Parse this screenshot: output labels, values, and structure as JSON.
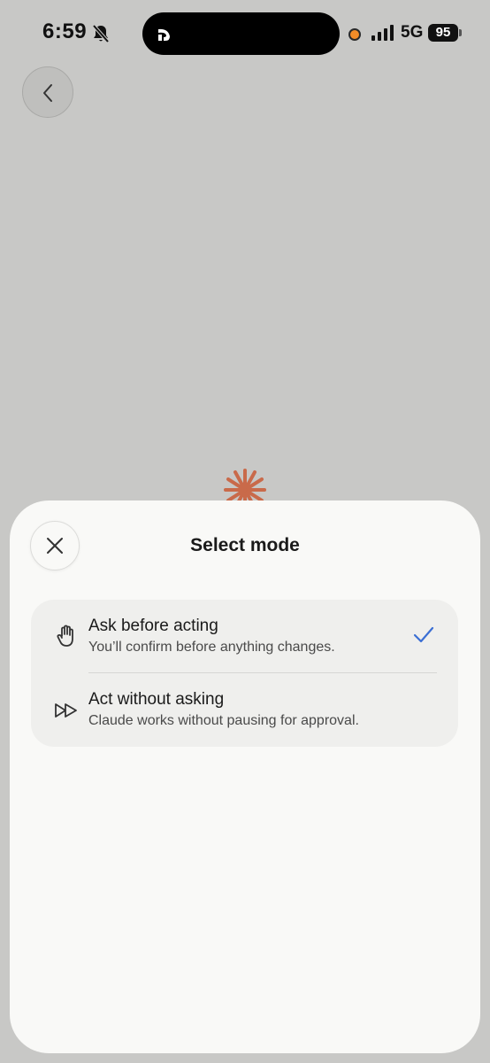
{
  "status_bar": {
    "time": "6:59",
    "network": "5G",
    "battery": "95"
  },
  "sheet": {
    "title": "Select mode",
    "modes": [
      {
        "title": "Ask before acting",
        "description": "You’ll confirm before anything changes.",
        "icon": "hand-icon",
        "selected": true
      },
      {
        "title": "Act without asking",
        "description": "Claude works without pausing for approval.",
        "icon": "fast-forward-icon",
        "selected": false
      }
    ]
  },
  "colors": {
    "background": "#c8c8c6",
    "sheet": "#f9f9f7",
    "accent_check": "#3b6fd4",
    "claude_spark": "#c96a4a"
  }
}
